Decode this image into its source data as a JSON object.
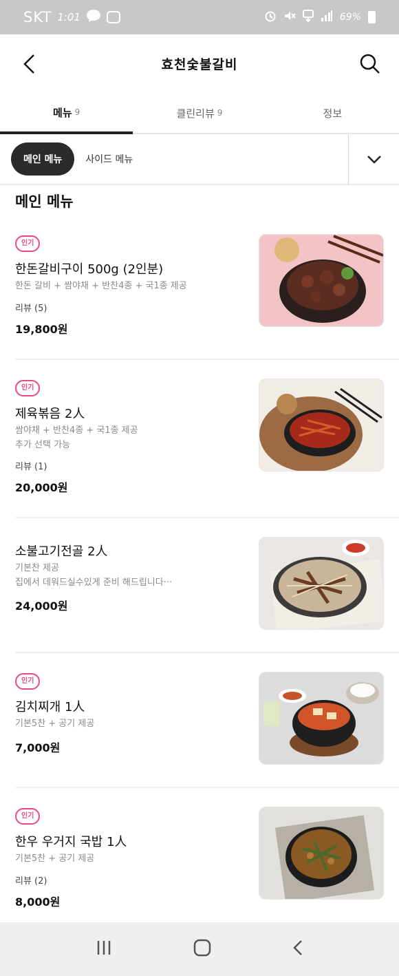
{
  "status_bar": {
    "carrier": "SKT",
    "time": "1:01",
    "battery": "69%"
  },
  "app_bar": {
    "title": "효천숯불갈비"
  },
  "tabs": [
    {
      "label": "메뉴",
      "count": "9"
    },
    {
      "label": "클린리뷰",
      "count": "9"
    },
    {
      "label": "정보",
      "count": ""
    }
  ],
  "categories": {
    "active": "메인 메뉴",
    "other": "사이드 메뉴"
  },
  "section_title": "메인 메뉴",
  "items": [
    {
      "badge": "인기",
      "name": "한돈갈비구이 500g (2인분)",
      "desc": [
        "한돈 갈비 + 쌈야채 + 반찬4종 + 국1종 제공"
      ],
      "review": "리뷰 (5)",
      "price": "19,800원",
      "image": "grilled-pork-ribs"
    },
    {
      "badge": "인기",
      "name": "제육볶음 2人",
      "desc": [
        "쌈야채 + 반찬4종 + 국1종 제공",
        "추가 선택 가능"
      ],
      "review": "리뷰 (1)",
      "price": "20,000원",
      "image": "spicy-stir-fried-pork"
    },
    {
      "badge": "",
      "name": "소불고기전골 2人",
      "desc": [
        "기본찬 제공",
        "집에서 데워드실수있게 준비 해드립니다···"
      ],
      "review": "",
      "price": "24,000원",
      "image": "bulgogi-hotpot"
    },
    {
      "badge": "인기",
      "name": "김치찌개 1人",
      "desc": [
        "기본5찬 + 공기 제공"
      ],
      "review": "",
      "price": "7,000원",
      "image": "kimchi-stew"
    },
    {
      "badge": "인기",
      "name": "한우 우거지 국밥 1人",
      "desc": [
        "기본5찬 + 공기 제공"
      ],
      "review": "리뷰 (2)",
      "price": "8,000원",
      "image": "beef-cabbage-soup"
    }
  ],
  "colors": {
    "accent_badge": "#e94a7a",
    "status_bar": "#c8c8c8",
    "chip_active": "#2b2b2b"
  }
}
